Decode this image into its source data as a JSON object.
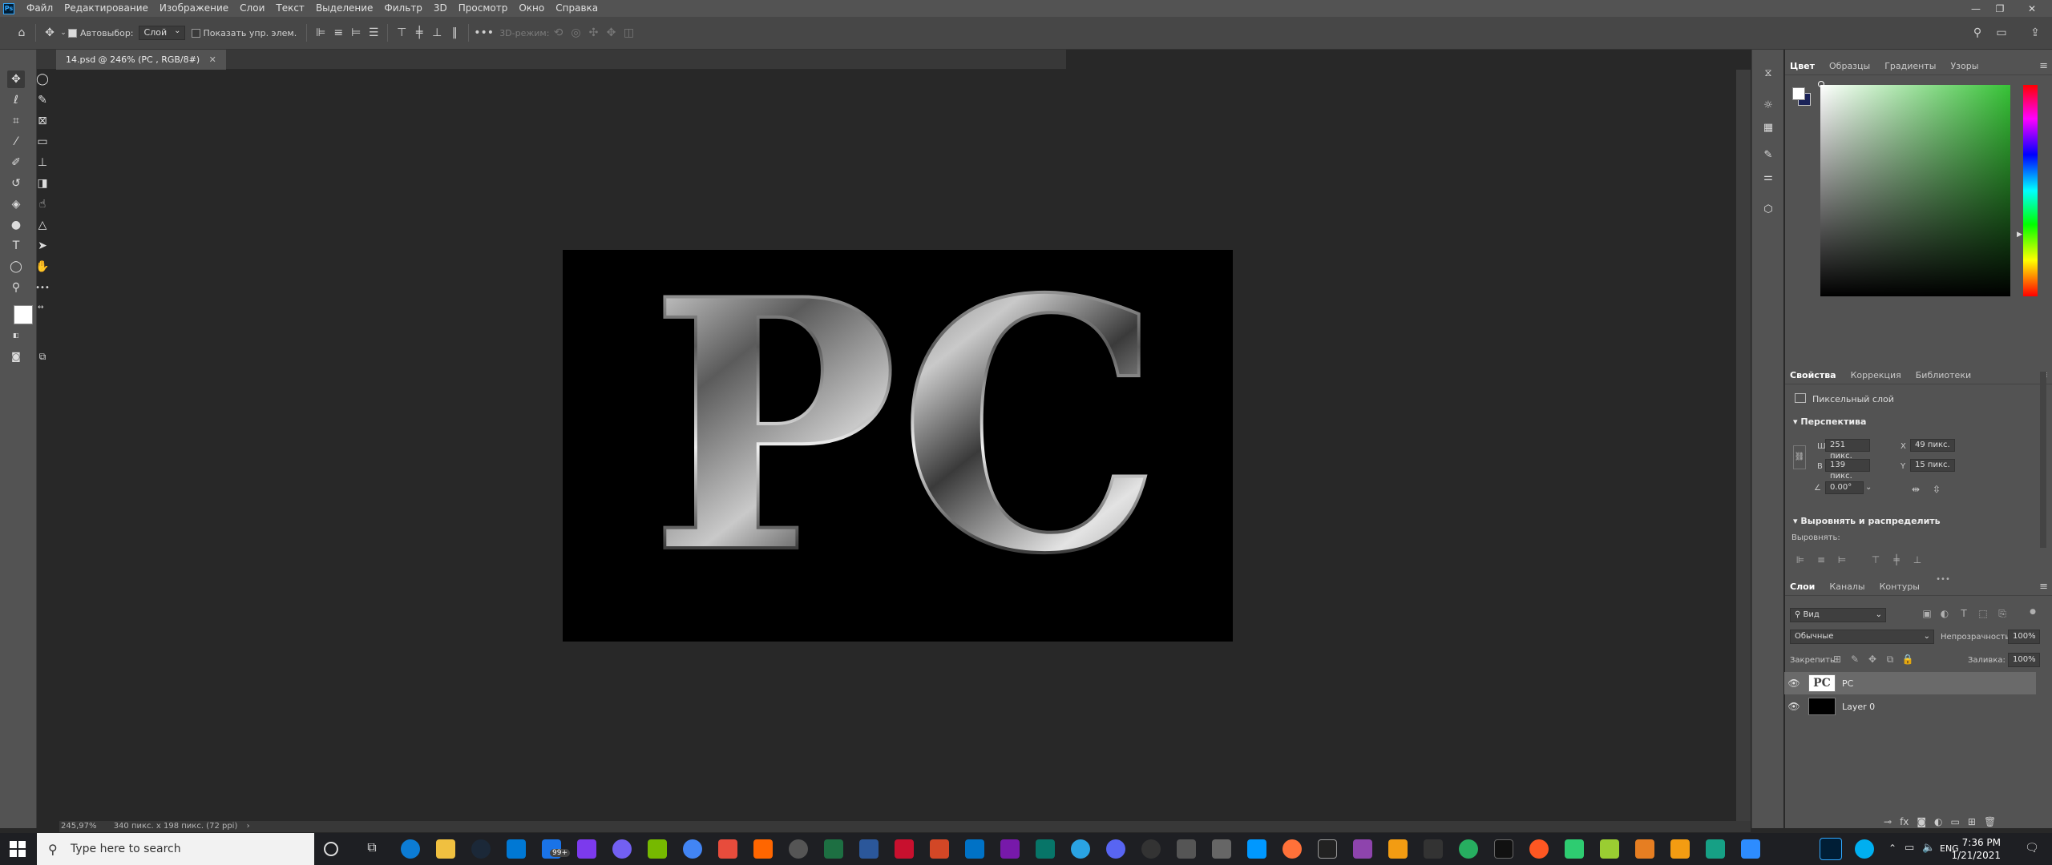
{
  "menubar": {
    "logo": "Ps",
    "items": [
      "Файл",
      "Редактирование",
      "Изображение",
      "Слои",
      "Текст",
      "Выделение",
      "Фильтр",
      "3D",
      "Просмотр",
      "Окно",
      "Справка"
    ],
    "window_controls": [
      "—",
      "❐",
      "✕"
    ]
  },
  "options_bar": {
    "autoselect_label": "Автовыбор:",
    "autoselect_checked": true,
    "autoselect_value": "Слой",
    "show_transform_label": "Показать упр. элем.",
    "show_transform_checked": false,
    "mode_3d_label": "3D-режим:",
    "more_icon": "•••"
  },
  "document": {
    "tab_title": "14.psd @ 246% (PC , RGB/8#)",
    "zoom": "245,97%",
    "size_info": "340 пикс. x 198 пикс. (72 ppi)",
    "text": "PC"
  },
  "tools": [
    {
      "name": "move-tool",
      "glyph": "✥",
      "selected": true
    },
    {
      "name": "marquee-tool",
      "glyph": "◯"
    },
    {
      "name": "lasso-tool",
      "glyph": "ℓ"
    },
    {
      "name": "quick-select-tool",
      "glyph": "✎"
    },
    {
      "name": "crop-tool",
      "glyph": "⌗"
    },
    {
      "name": "frame-tool",
      "glyph": "⊠"
    },
    {
      "name": "eyedropper-tool",
      "glyph": "⁄"
    },
    {
      "name": "ruler-tool",
      "glyph": "▭"
    },
    {
      "name": "brush-tool",
      "glyph": "✐"
    },
    {
      "name": "stamp-tool",
      "glyph": "⊥"
    },
    {
      "name": "history-brush-tool",
      "glyph": "↺"
    },
    {
      "name": "eraser-tool",
      "glyph": "◨"
    },
    {
      "name": "bucket-tool",
      "glyph": "◈"
    },
    {
      "name": "smudge-tool",
      "glyph": "☝"
    },
    {
      "name": "dodge-tool",
      "glyph": "●"
    },
    {
      "name": "path-tool",
      "glyph": "△"
    },
    {
      "name": "type-tool",
      "glyph": "T"
    },
    {
      "name": "direct-select-tool",
      "glyph": "➤"
    },
    {
      "name": "shape-tool",
      "glyph": "◯"
    },
    {
      "name": "hand-tool",
      "glyph": "✋"
    },
    {
      "name": "zoom-tool",
      "glyph": "⚲"
    },
    {
      "name": "more-tools",
      "glyph": "•••"
    }
  ],
  "color_panel": {
    "tabs": [
      "Цвет",
      "Образцы",
      "Градиенты",
      "Узоры"
    ],
    "foreground": "#ffffff",
    "background": "#1b2358"
  },
  "properties_panel": {
    "tabs": [
      "Свойства",
      "Коррекция",
      "Библиотеки"
    ],
    "layer_type": "Пиксельный слой",
    "transform_section": "Перспектива",
    "w_label": "Ш",
    "w_value": "251 пикс.",
    "h_label": "В",
    "h_value": "139 пикс.",
    "x_label": "X",
    "x_value": "49 пикс.",
    "y_label": "Y",
    "y_value": "15 пикс.",
    "angle_value": "0.00°",
    "align_section": "Выровнять и распределить",
    "align_label": "Выровнять:",
    "more": "•••"
  },
  "layers_panel": {
    "tabs": [
      "Слои",
      "Каналы",
      "Контуры"
    ],
    "filter_value": "Вид",
    "blend_mode": "Обычные",
    "opacity_label": "Непрозрачность:",
    "opacity_value": "100%",
    "lock_label": "Закрепить:",
    "fill_label": "Заливка:",
    "fill_value": "100%",
    "layers": [
      {
        "name": "PC",
        "thumb_text": "PC",
        "visible": true,
        "selected": true
      },
      {
        "name": "Layer 0",
        "thumb_text": "",
        "visible": true,
        "selected": false
      }
    ]
  },
  "taskbar": {
    "search_placeholder": "Type here to search",
    "language": "ENG",
    "time": "7:36 PM",
    "date": "1/21/2021",
    "badge": "99+"
  }
}
